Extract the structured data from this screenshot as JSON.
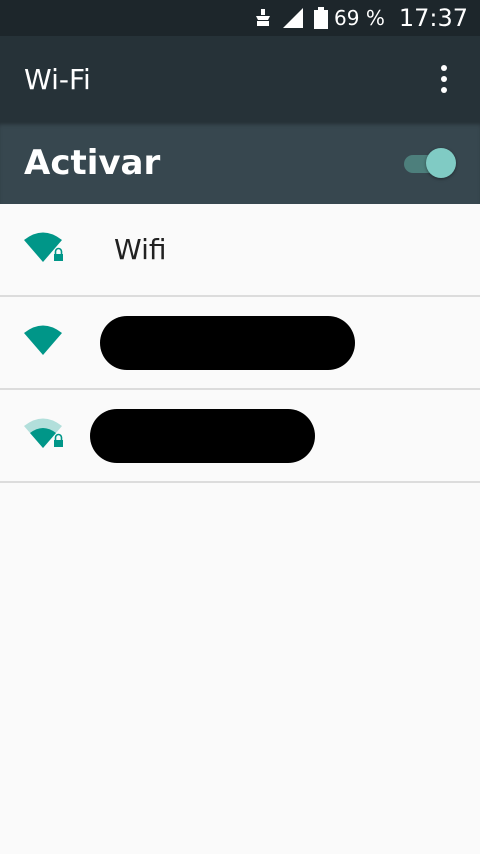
{
  "status_bar": {
    "icons": [
      "notification-icon",
      "signal-icon",
      "battery-icon"
    ],
    "battery": "69 %",
    "time": "17:37"
  },
  "app_bar": {
    "title": "Wi-Fi",
    "overflow_icon": "overflow-menu-icon"
  },
  "master_switch": {
    "label": "Activar",
    "checked": true,
    "accent_color": "#80cbc4"
  },
  "networks": [
    {
      "name": "Wifi",
      "signal": "full",
      "secured": true,
      "redacted": false
    },
    {
      "name": "",
      "signal": "full",
      "secured": false,
      "redacted": true
    },
    {
      "name": "",
      "signal": "medium",
      "secured": true,
      "redacted": true
    }
  ],
  "colors": {
    "status_bar": "#1d262b",
    "app_bar": "#263238",
    "switch_bar": "#37474f",
    "wifi_icon": "#009688",
    "wifi_icon_dim": "#b2dfdb"
  }
}
